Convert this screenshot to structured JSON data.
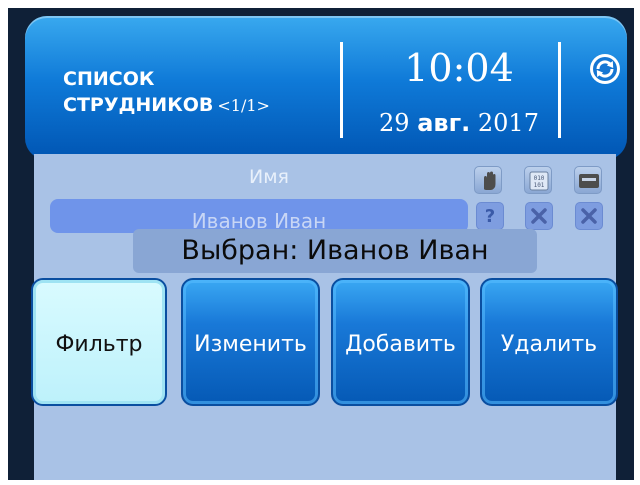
{
  "header": {
    "title_line1": "СПИСОК",
    "title_line2": "СТРУДНИКОВ",
    "pagination": "<1/1>",
    "time": "10:04",
    "date_day": "29",
    "date_month": "авг.",
    "date_year": "2017",
    "sync_icon": "refresh-icon"
  },
  "list": {
    "column_name": "Имя",
    "column_icons": [
      "hand-icon",
      "binary-code-icon",
      "card-icon"
    ],
    "rows": [
      {
        "name": "Иванов Иван",
        "status": "?"
      }
    ]
  },
  "selected_banner": "Выбран: Иванов Иван",
  "actions": {
    "filter": "Фильтр",
    "edit": "Изменить",
    "add": "Добавить",
    "delete": "Удалить"
  },
  "colors": {
    "header_blue": "#1479d6",
    "panel": "#a9c2e6",
    "active_button": "#c9f6fc"
  }
}
